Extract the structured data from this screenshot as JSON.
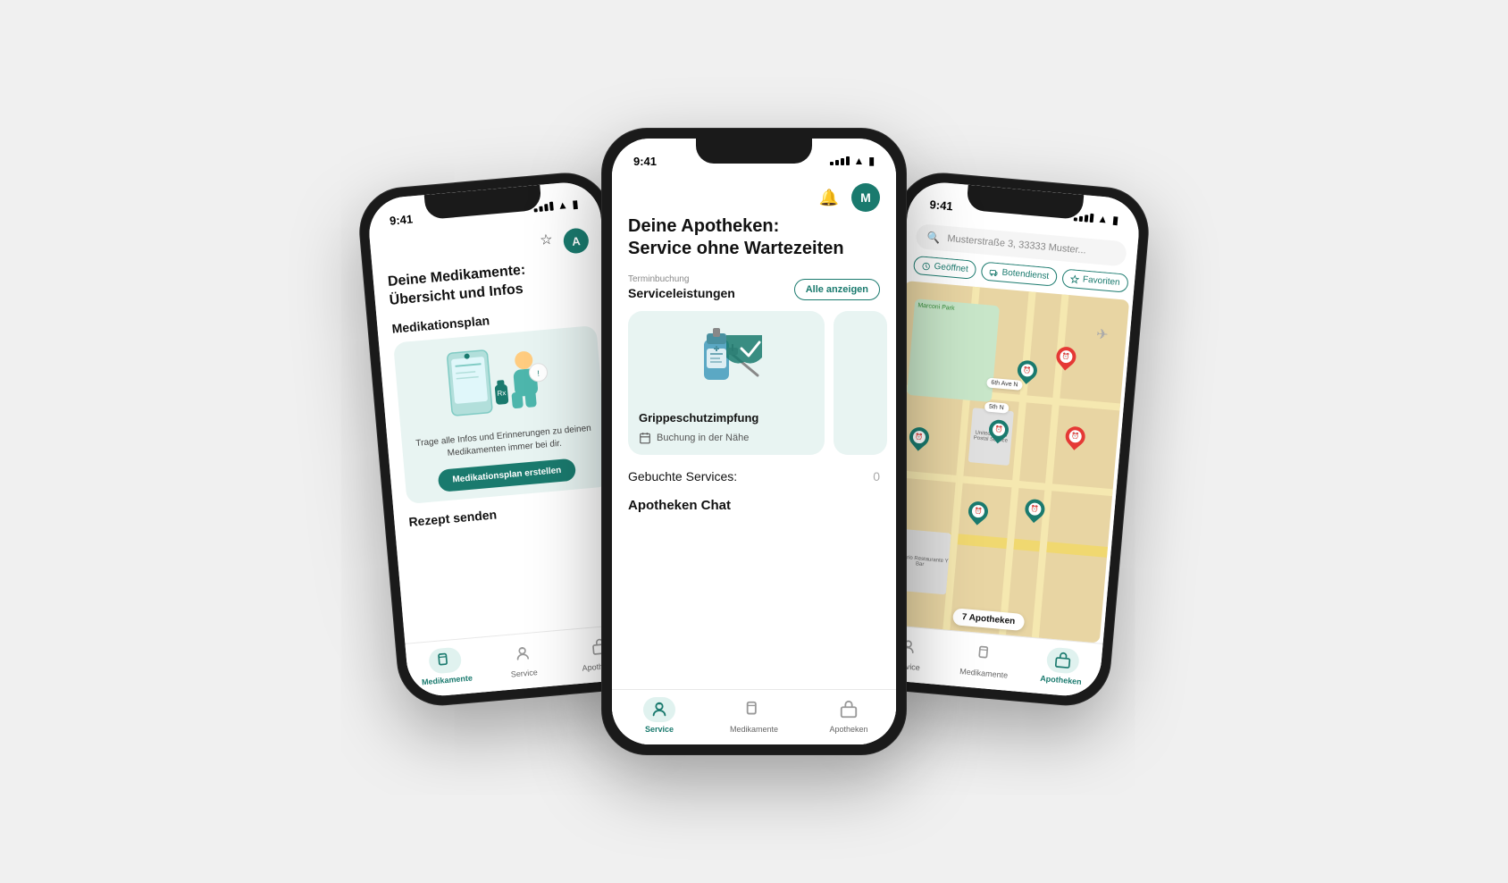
{
  "phones": {
    "left": {
      "status_time": "9:41",
      "header_icon": "☆",
      "avatar_letter": "A",
      "title": "Deine Medikamente:\nÜbersicht und Infos",
      "section_medikation": "Medikationsplan",
      "medi_card_text": "Trage alle Infos und Erinnerungen zu\ndeinen Medikamenten immer bei dir.",
      "medi_button": "Medikationsplan erstellen",
      "section_rezept": "Rezept senden",
      "nav": [
        {
          "label": "Medikamente",
          "icon": "🗑",
          "active": true
        },
        {
          "label": "Service",
          "icon": "⚕",
          "active": false
        },
        {
          "label": "Apotheken",
          "icon": "🏪",
          "active": false
        }
      ]
    },
    "center": {
      "status_time": "9:41",
      "avatar_letter": "M",
      "title": "Deine Apotheken:\nService ohne Wartezeiten",
      "terminbuchung_label": "Terminbuchung",
      "serviceleistungen": "Serviceleistungen",
      "alle_anzeigen": "Alle anzeigen",
      "card1_title": "Grippeschutzimpfung",
      "card1_sub": "Buchung in der Nähe",
      "gebuchte_label": "Gebuchte Services:",
      "gebuchte_count": "0",
      "apotheken_chat": "Apotheken Chat",
      "nav": [
        {
          "label": "Service",
          "icon": "⚕",
          "active": true
        },
        {
          "label": "Medikamente",
          "icon": "🗑",
          "active": false
        },
        {
          "label": "Apotheken",
          "icon": "🏪",
          "active": false
        }
      ]
    },
    "right": {
      "status_time": "9:41",
      "search_placeholder": "Musterstraße 3, 33333 Muster...",
      "filters": [
        "Geöffnet",
        "Botendienst",
        "Favoriten"
      ],
      "apotheken_count": "7 Apotheken",
      "nav": [
        {
          "label": "Service",
          "icon": "⚕",
          "active": false
        },
        {
          "label": "Medikamente",
          "icon": "🗑",
          "active": false
        },
        {
          "label": "Apotheken",
          "icon": "🏪",
          "active": true
        }
      ]
    }
  },
  "colors": {
    "primary": "#1a7a6e",
    "primary_light": "#e0f2ef",
    "card_bg": "#e8f4f2",
    "red_pin": "#e53935"
  }
}
